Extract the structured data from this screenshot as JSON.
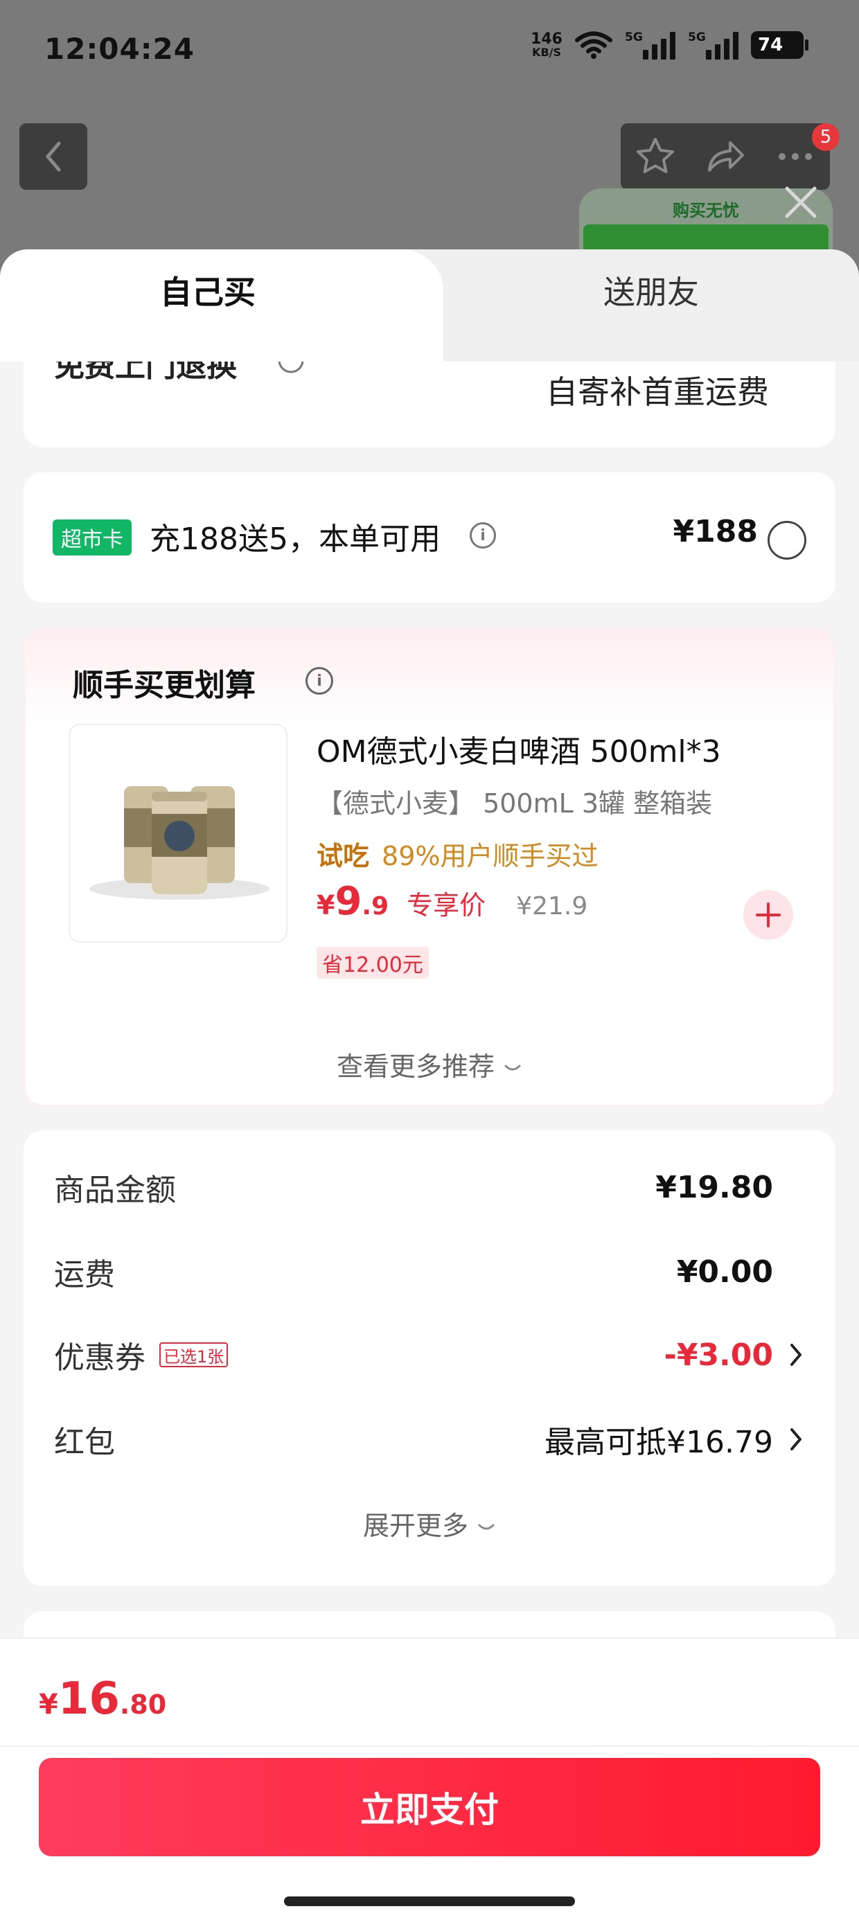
{
  "status_bar": {
    "time": "12:04:24",
    "net_speed_value": "146",
    "net_speed_unit": "KB/S",
    "sim1_label": "5G",
    "sim2_label": "5G",
    "battery": "74"
  },
  "header": {
    "notification_count": "5",
    "worry_free_label": "购买无忧"
  },
  "tabs": {
    "self": "自己买",
    "friend": "送朋友"
  },
  "delivery": {
    "left_label": "免费上门退换",
    "right_label": "自寄补首重运费"
  },
  "market_card": {
    "tag": "超市卡",
    "text": "充188送5，本单可用",
    "price": "¥188"
  },
  "addon": {
    "title": "顺手买更划算",
    "product": {
      "name": "OM德式小麦白啤酒  500ml*3",
      "spec": "【德式小麦】 500mL 3罐 整箱装",
      "trial_label": "试吃",
      "trial_rate": "89%用户顺手买过",
      "price_yen": "¥",
      "price_int": "9",
      "price_dec": ".9",
      "price_tag": "专享价",
      "original_price": "¥21.9",
      "save": "省12.00元"
    },
    "more_label": "查看更多推荐"
  },
  "summary": {
    "rows": [
      {
        "label": "商品金额",
        "value": "¥19.80"
      },
      {
        "label": "运费",
        "value": "¥0.00"
      },
      {
        "label": "优惠券",
        "tag": "已选1张",
        "value": "-¥3.00"
      },
      {
        "label": "红包",
        "value": "最高可抵¥16.79"
      }
    ],
    "expand_label": "展开更多"
  },
  "footer": {
    "total_yen": "¥",
    "total_int": "16",
    "total_dec": ".80",
    "pay_label": "立即支付"
  },
  "colors": {
    "accent_red": "#e8293a",
    "market_green": "#12b766",
    "trial_orange": "#c4730c"
  },
  "icons": [
    "back-chevron-icon",
    "star-icon",
    "share-icon",
    "more-dots-icon",
    "close-icon",
    "info-icon",
    "radio-icon",
    "plus-icon",
    "chevron-down-icon",
    "chevron-right-icon",
    "wifi-icon",
    "signal-icon",
    "battery-icon"
  ]
}
